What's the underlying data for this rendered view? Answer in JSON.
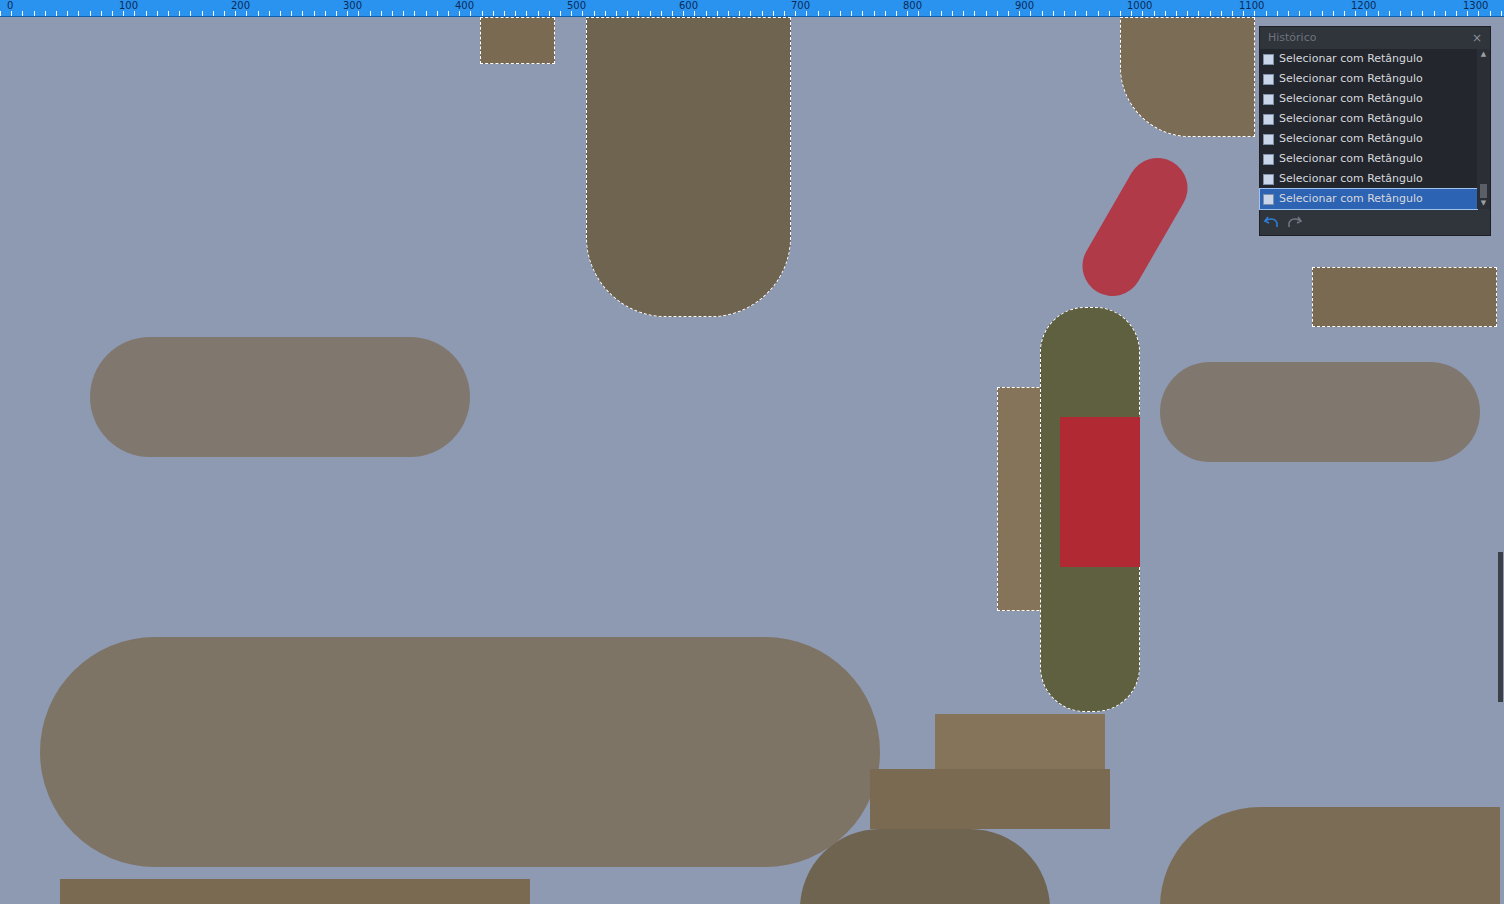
{
  "ruler": {
    "ticks": [
      "0",
      "100",
      "200",
      "300",
      "400",
      "500",
      "600",
      "700",
      "800",
      "900",
      "1000",
      "1100",
      "1200",
      "1300"
    ]
  },
  "history": {
    "title": "Histórico",
    "close": "×",
    "items": [
      {
        "label": "Selecionar com Retângulo",
        "selected": false
      },
      {
        "label": "Selecionar com Retângulo",
        "selected": false
      },
      {
        "label": "Selecionar com Retângulo",
        "selected": false
      },
      {
        "label": "Selecionar com Retângulo",
        "selected": false
      },
      {
        "label": "Selecionar com Retângulo",
        "selected": false
      },
      {
        "label": "Selecionar com Retângulo",
        "selected": false
      },
      {
        "label": "Selecionar com Retângulo",
        "selected": false
      },
      {
        "label": "Selecionar com Retângulo",
        "selected": true
      }
    ]
  }
}
